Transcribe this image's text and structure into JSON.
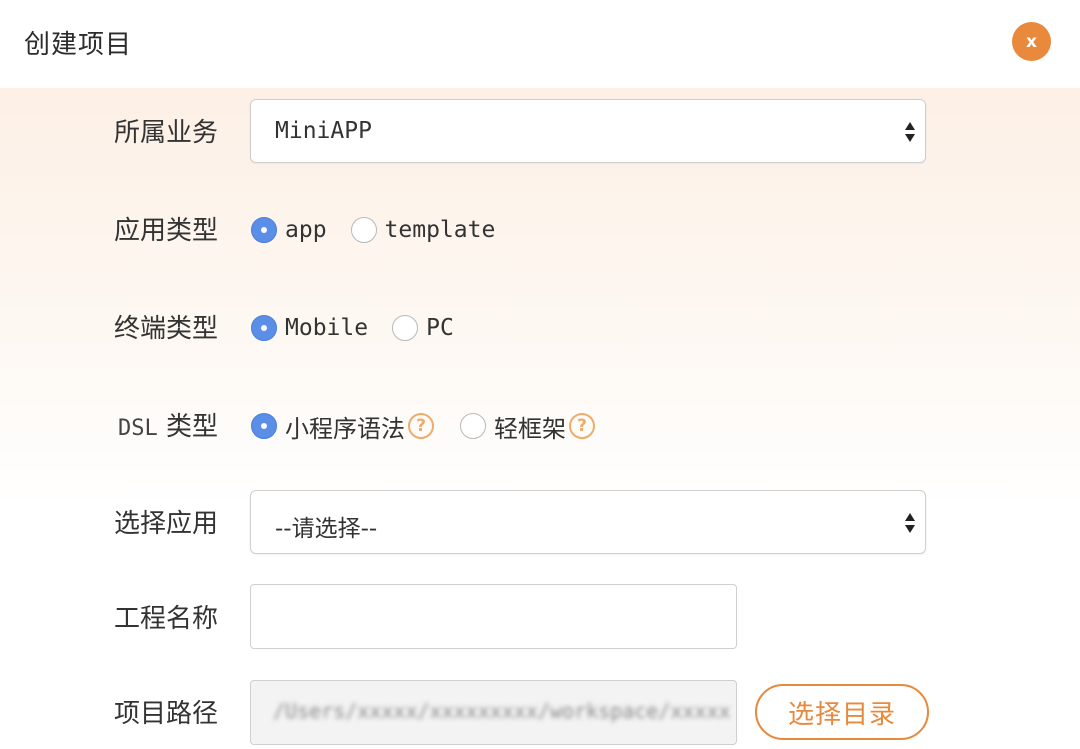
{
  "dialog": {
    "title": "创建项目",
    "close_label": "x"
  },
  "form": {
    "business": {
      "label": "所属业务",
      "value": "MiniAPP"
    },
    "app_type": {
      "label": "应用类型",
      "options": [
        {
          "label": "app",
          "selected": true
        },
        {
          "label": "template",
          "selected": false
        }
      ]
    },
    "terminal_type": {
      "label": "终端类型",
      "options": [
        {
          "label": "Mobile",
          "selected": true
        },
        {
          "label": "PC",
          "selected": false
        }
      ]
    },
    "dsl_type": {
      "label_prefix": "DSL",
      "label_suffix": "类型",
      "options": [
        {
          "label": "小程序语法",
          "selected": true,
          "help": "?"
        },
        {
          "label": "轻框架",
          "selected": false,
          "help": "?"
        }
      ]
    },
    "select_app": {
      "label": "选择应用",
      "value": "--请选择--"
    },
    "project_name": {
      "label": "工程名称",
      "value": ""
    },
    "project_path": {
      "label": "项目路径",
      "value": "/Users/xxxxx/xxxxxxxxx/workspace/xxxxx/xxxxxx",
      "button_label": "选择目录"
    }
  },
  "colors": {
    "accent": "#e8893c",
    "radio_selected": "#5b8ee6",
    "help_icon": "#efab6a"
  }
}
